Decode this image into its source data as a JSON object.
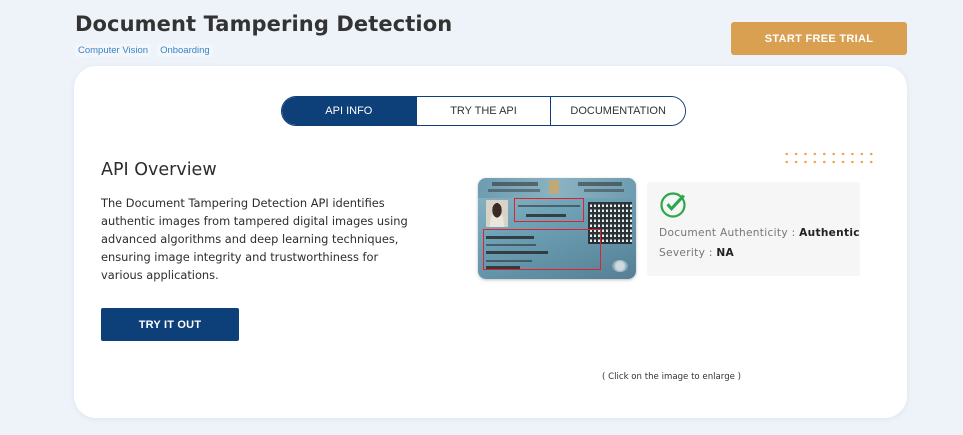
{
  "header": {
    "title": "Document Tampering Detection",
    "tags": [
      "Computer Vision",
      "Onboarding"
    ],
    "trial_button": "START FREE TRIAL"
  },
  "tabs": [
    {
      "label": "API INFO",
      "active": true
    },
    {
      "label": "TRY THE API",
      "active": false
    },
    {
      "label": "DOCUMENTATION",
      "active": false
    }
  ],
  "overview": {
    "title": "API Overview",
    "description": "The Document Tampering Detection API identifies authentic images from tampered digital images using advanced algorithms and deep learning techniques, ensuring image integrity and trustworthiness for various applications.",
    "try_button": "TRY IT OUT"
  },
  "result": {
    "authenticity_label": "Document Authenticity :",
    "authenticity_value": "Authentic",
    "severity_label": "Severity :",
    "severity_value": "NA",
    "icon": "check-icon"
  },
  "image_note": "( Click on the image to enlarge )",
  "colors": {
    "primary": "#0d3f78",
    "accent": "#d9a052",
    "tag_text": "#3b82c4",
    "check": "#2aa84a",
    "flag_box": "#e0222d"
  }
}
